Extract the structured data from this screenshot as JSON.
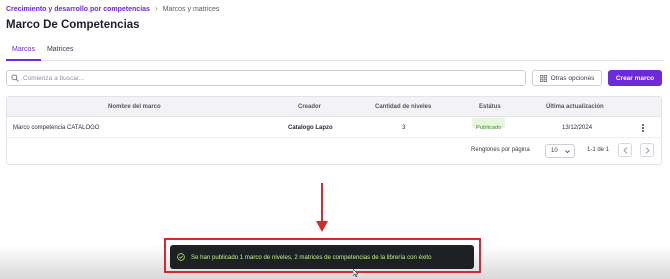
{
  "breadcrumb": {
    "parent": "Crecimiento y desarrollo por competencias",
    "current": "Marcos y matrices"
  },
  "page": {
    "title": "Marco De Competencias"
  },
  "tabs": [
    {
      "label": "Marcos",
      "active": true
    },
    {
      "label": "Matrices",
      "active": false
    }
  ],
  "search": {
    "placeholder": "Comienza a buscar...",
    "value": ""
  },
  "toolbar": {
    "options_label": "Otras opciones",
    "create_label": "Crear marco"
  },
  "table": {
    "columns": [
      "Nombre del marco",
      "Creador",
      "Cantidad de niveles",
      "Estátus",
      "Última actualización"
    ],
    "rows": [
      {
        "name": "Marco competencia CATALOGO",
        "creator": "Catalogo Lapzo",
        "levels": "3",
        "status": "Publicado",
        "updated": "13/12/2024"
      }
    ]
  },
  "pagination": {
    "rows_label": "Renglones por página",
    "rows_per_page": "10",
    "range": "1-1 de 1"
  },
  "toast": {
    "message": "Se han publicado 1 marco de niveles, 2 matrices de competencias de la librería con éxito"
  },
  "colors": {
    "brand": "#6c2bd9",
    "status_published_bg": "#e6f6df",
    "status_published_text": "#3f8a2e",
    "toast_bg": "#1d2124",
    "toast_text": "#c6ef8a",
    "annotation": "#d42a2a"
  },
  "icons": {
    "breadcrumb_separator": "chevron-right-icon",
    "search": "search-icon",
    "options": "grid-icon",
    "row_menu": "kebab-menu-icon",
    "select": "chevron-down-icon",
    "prev": "chevron-left-icon",
    "next": "chevron-right-icon",
    "toast": "check-circle-icon"
  }
}
